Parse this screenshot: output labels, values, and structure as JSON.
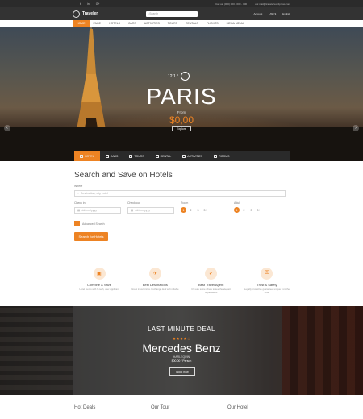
{
  "topbar": {
    "social": [
      "f",
      "t",
      "in",
      "G+"
    ],
    "phone": "Call us: (000) 000 - 000 - 000",
    "email": "our.mail@travelerwordpress.com"
  },
  "header": {
    "logo": "Traveler",
    "search_placeholder": "Search",
    "account": "Account",
    "currency": "USD $",
    "language": "English"
  },
  "nav": [
    {
      "label": "HOME",
      "active": true
    },
    {
      "label": "PAGE"
    },
    {
      "label": "HOTELS"
    },
    {
      "label": "CARS"
    },
    {
      "label": "ACTIVITIES"
    },
    {
      "label": "TOURS"
    },
    {
      "label": "RENTALS"
    },
    {
      "label": "FLIGHTS"
    },
    {
      "label": "MEGA MENU"
    }
  ],
  "hero": {
    "temperature": "12.1 °",
    "city": "PARIS",
    "from_label": "From",
    "price": "$0,00",
    "explore": "Explore"
  },
  "tabs": [
    {
      "label": "HOTEL",
      "active": true
    },
    {
      "label": "CARS"
    },
    {
      "label": "TOURS"
    },
    {
      "label": "RENTAL"
    },
    {
      "label": "ACTIVITIES"
    },
    {
      "label": "ROOMS"
    }
  ],
  "search": {
    "title": "Search and Save on Hotels",
    "where_label": "Where",
    "where_placeholder": "Destination, city, hotel",
    "checkin_label": "Check in",
    "checkout_label": "Check out",
    "date_placeholder": "dd/mm/yyyy",
    "rooms_label": "Room",
    "adult_label": "Adult",
    "counts": [
      "1",
      "2",
      "3",
      "3+"
    ],
    "advanced": "Advanced Search",
    "button": "Search for Hotels"
  },
  "features": [
    {
      "title": "Combine & Save",
      "desc": "Hotel rooms with hi-tech, user applicant",
      "icon": "briefcase-icon"
    },
    {
      "title": "Best Destinations",
      "desc": "Great travel prices. Exchange deal with reliable",
      "icon": "plane-icon"
    },
    {
      "title": "Best Travel Agent",
      "desc": "It's sure some where to see the elegant unparalleled",
      "icon": "thumbs-up-icon"
    },
    {
      "title": "Trust & Safety",
      "desc": "Legally protective guarantee, unique from the order",
      "icon": "lock-icon"
    }
  ],
  "deal": {
    "title": "LAST MINUTE DEAL",
    "stars": "★★★★☆",
    "name": "Mercedes Benz",
    "location": "HARLEQUIN",
    "price": "$00.00 / Person",
    "button": "Book now"
  },
  "bottom": [
    "Hot Deals",
    "Our Tour",
    "Our Hotel"
  ]
}
